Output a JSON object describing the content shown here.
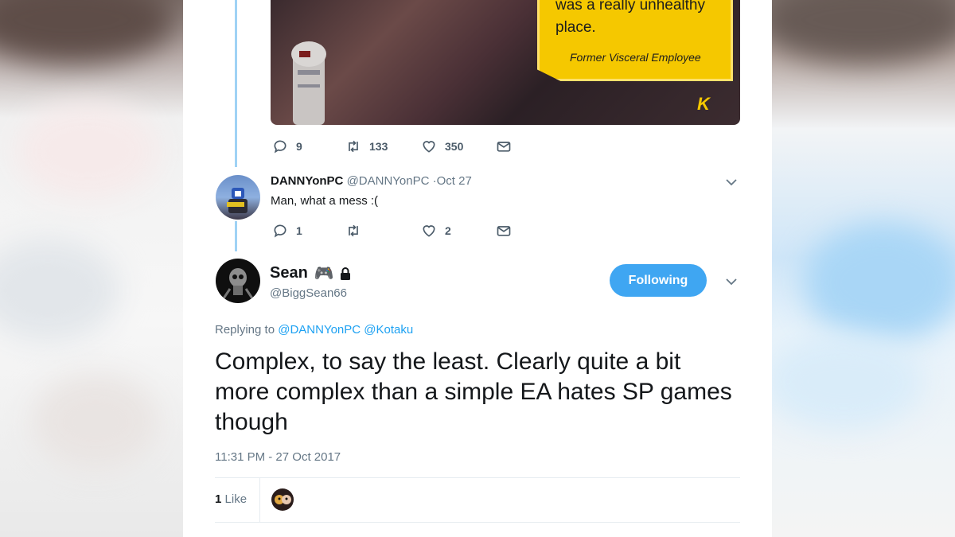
{
  "image": {
    "quote_line1": "was a really unhealthy",
    "quote_line2": "place.",
    "quote_author": "Former Visceral Employee",
    "logo": "K"
  },
  "tweet1_actions": {
    "replies": "9",
    "retweets": "133",
    "likes": "350"
  },
  "reply1": {
    "name": "DANNYonPC",
    "handle": "@DANNYonPC",
    "date": "·Oct 27",
    "text": "Man, what a mess :(",
    "replies": "1",
    "likes": "2"
  },
  "main_tweet": {
    "name": "Sean",
    "emoji": "🎮",
    "handle": "@BiggSean66",
    "follow_label": "Following",
    "replying_prefix": "Replying to",
    "replying_1": "@DANNYonPC",
    "replying_2": "@Kotaku",
    "text": "Complex, to say the least. Clearly quite a bit more complex than a simple EA hates SP games though",
    "timestamp": "11:31 PM - 27 Oct 2017",
    "like_count": "1",
    "like_label": "Like"
  },
  "colors": {
    "accent": "#1da1f2",
    "follow_bg": "#3fa6f2",
    "thread": "#9fd2f5",
    "quote_yellow": "#f5c800"
  }
}
